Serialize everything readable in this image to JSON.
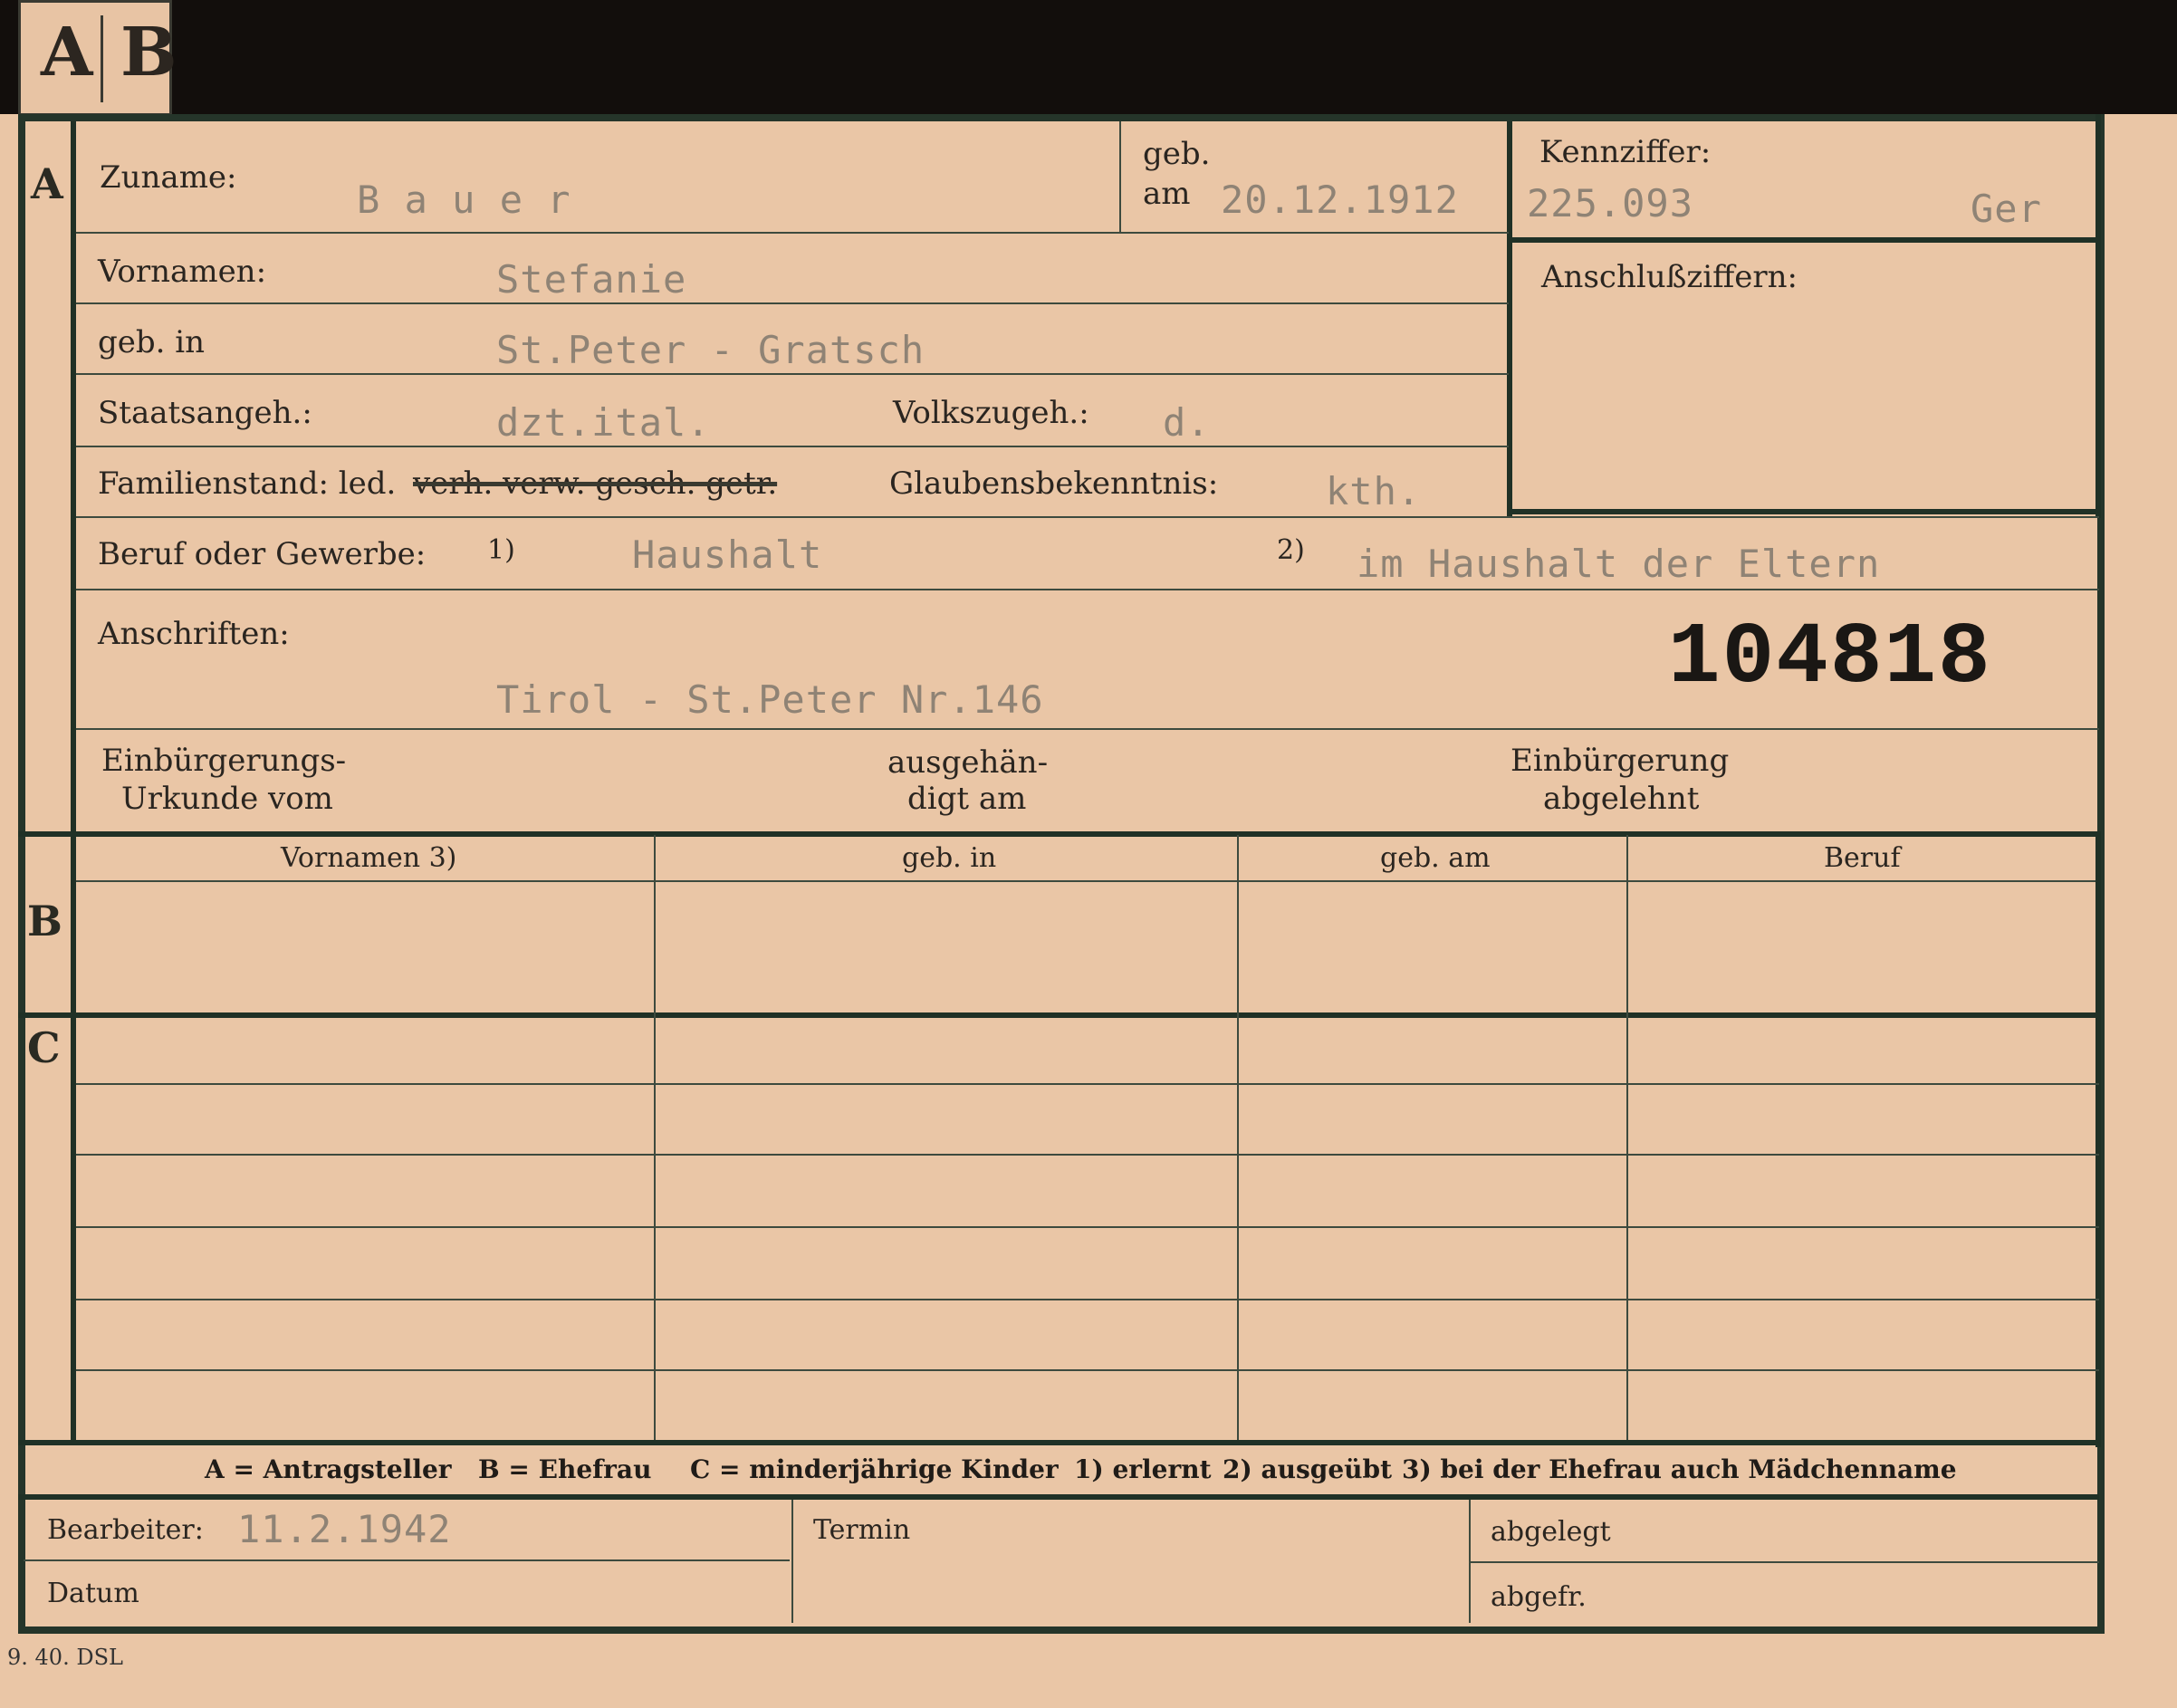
{
  "tabs": {
    "a": "A",
    "b": "B"
  },
  "sections": {
    "a": "A",
    "b": "B",
    "c": "C"
  },
  "header": {
    "surname_label": "Zuname:",
    "surname_value": "B a u e r",
    "born_on_label_1": "geb.",
    "born_on_label_2": "am",
    "born_on_value": "20.12.1912",
    "code_label": "Kennziffer:",
    "code_value": "225.093",
    "code_suffix": "Ger",
    "followup_label": "Anschlußziffern:"
  },
  "fields": {
    "first_names_label": "Vornamen:",
    "first_names_value": "Stefanie",
    "born_in_label": "geb. in",
    "born_in_value": "St.Peter - Gratsch",
    "citizenship_label": "Staatsangeh.:",
    "citizenship_value": "dzt.ital.",
    "ethnicity_label": "Volkszugeh.:",
    "ethnicity_value": "d.",
    "marital_label": "Familienstand: led.",
    "marital_struck": "verh. verw. gesch. getr.",
    "religion_label": "Glaubensbekenntnis:",
    "religion_value": "kth.",
    "occupation_label": "Beruf oder Gewerbe:",
    "occupation_note1": "1)",
    "occupation_value1": "Haushalt",
    "occupation_note2": "2)",
    "occupation_value2": "im Haushalt der Eltern",
    "address_label": "Anschriften:",
    "address_value": "Tirol - St.Peter Nr.146",
    "stamp_number": "104818",
    "naturalization_cert_1": "Einbürgerungs-",
    "naturalization_cert_2": "Urkunde vom",
    "handed_1": "ausgehän-",
    "handed_2": "digt am",
    "refused_1": "Einbürgerung",
    "refused_2": "abgelehnt"
  },
  "table": {
    "headers": [
      "Vornamen 3)",
      "geb. in",
      "geb. am",
      "Beruf"
    ]
  },
  "legend": {
    "a": "A = Antragsteller",
    "b": "B = Ehefrau",
    "c": "C = minderjährige Kinder",
    "n1": "1) erlernt",
    "n2": "2) ausgeübt",
    "n3": "3) bei der Ehefrau auch Mädchenname"
  },
  "footer": {
    "processor_label": "Bearbeiter:",
    "processor_value": "11.2.1942",
    "date_label": "Datum",
    "deadline_label": "Termin",
    "filed_label": "abgelegt",
    "sent_label": "abgefr.",
    "print_code": "9. 40. DSL"
  }
}
